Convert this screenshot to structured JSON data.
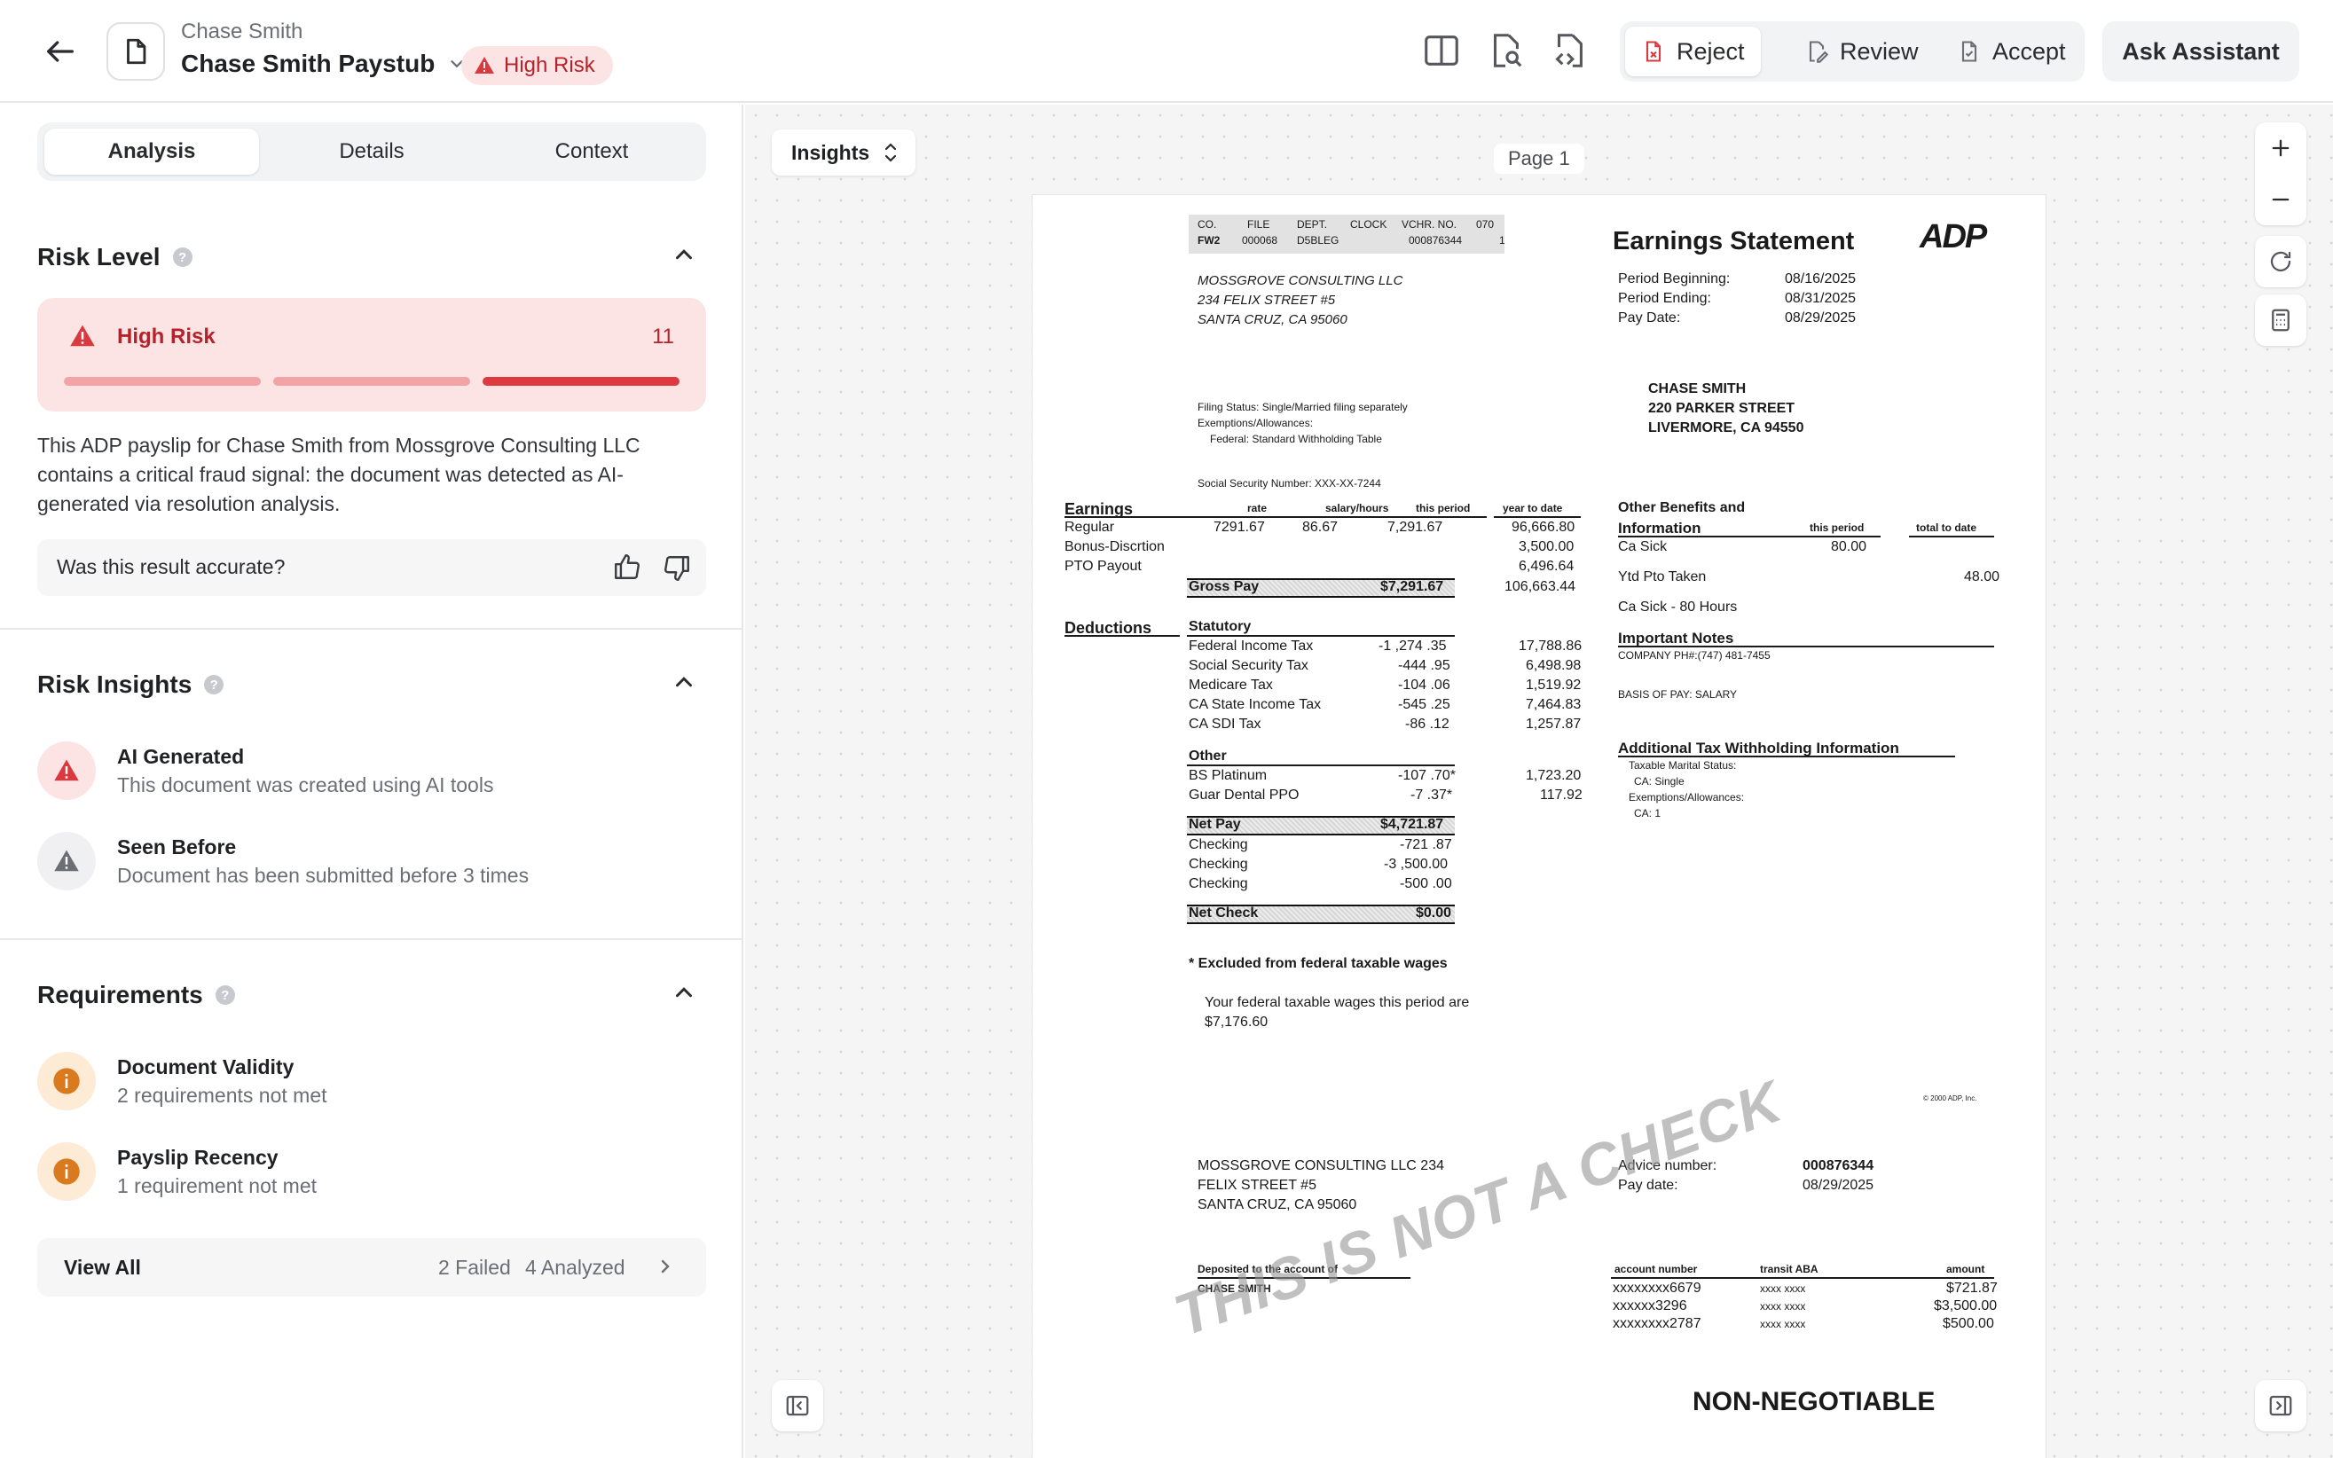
{
  "header": {
    "subtitle": "Chase Smith",
    "title": "Chase Smith Paystub",
    "risk_badge": "High Risk",
    "reject": "Reject",
    "review": "Review",
    "accept": "Accept",
    "ask": "Ask Assistant"
  },
  "tabs": [
    "Analysis",
    "Details",
    "Context"
  ],
  "risk": {
    "heading": "Risk Level",
    "level": "High Risk",
    "score": "11",
    "summary": "This ADP payslip for Chase Smith from Mossgrove Consulting LLC contains a critical fraud signal: the document was detected as AI-generated via resolution analysis.",
    "feedback": "Was this result accurate?"
  },
  "insights": {
    "heading": "Risk Insights",
    "items": [
      {
        "title": "AI Generated",
        "desc": "This document was created using AI tools"
      },
      {
        "title": "Seen Before",
        "desc": "Document has been submitted before 3 times"
      }
    ]
  },
  "requirements": {
    "heading": "Requirements",
    "items": [
      {
        "title": "Document Validity",
        "desc": "2 requirements not met"
      },
      {
        "title": "Payslip Recency",
        "desc": "1 requirement not met"
      }
    ],
    "view_all": "View All",
    "failed": "2 Failed",
    "analyzed": "4 Analyzed"
  },
  "viewer": {
    "insights_select": "Insights",
    "page_label": "Page 1"
  },
  "doc": {
    "code_hdr": [
      "CO.",
      "FILE",
      "DEPT.",
      "CLOCK",
      "VCHR. NO.",
      "070"
    ],
    "code_val": [
      "FW2",
      "000068",
      "D5BLEG",
      "000876344",
      "1"
    ],
    "company": [
      "MOSSGROVE    CONSULTING    LLC",
      "234  FELIX   STREET   #5",
      "SANTA   CRUZ,   CA  95060"
    ],
    "title": "Earnings  Statement",
    "logo": "ADP",
    "period_labels": [
      "Period  Beginning:",
      "Period  Ending:",
      "Pay  Date:"
    ],
    "period_values": [
      "08/16/2025",
      "08/31/2025",
      "08/29/2025"
    ],
    "employee": [
      "CHASE   SMITH",
      "220  PARKER   STREET",
      "LIVERMORE,  CA   94550"
    ],
    "filing": [
      "Filing  Status:  Single/Married    filing  separately",
      "Exemptions/Allowances:",
      "Federal:  Standard   Withholding   Table"
    ],
    "ssn": "Social  Security   Number:    XXX-XX-7244",
    "earn_hdr": {
      "title": "Earnings",
      "rate": "rate",
      "hours": "salary/hours",
      "period": "this  period",
      "ytd": "year  to  date"
    },
    "earnings": [
      {
        "name": "Regular",
        "rate": "7291.67",
        "hours": "86.67",
        "period": "7,291.67",
        "ytd": "96,666.80"
      },
      {
        "name": "Bonus-Discrtion",
        "rate": "",
        "hours": "",
        "period": "",
        "ytd": "3,500.00"
      },
      {
        "name": "PTO  Payout",
        "rate": "",
        "hours": "",
        "period": "",
        "ytd": "6,496.64"
      }
    ],
    "gross": {
      "label": "Gross  Pay",
      "period": "$7,291.67",
      "ytd": "106,663.44"
    },
    "ded_title": "Deductions",
    "statutory": "Statutory",
    "deductions": [
      {
        "name": "Federal  Income  Tax",
        "period": "-1 ,274 .35",
        "ytd": "17,788.86"
      },
      {
        "name": "Social  Security  Tax",
        "period": "-444 .95",
        "ytd": "6,498.98"
      },
      {
        "name": "Medicare  Tax",
        "period": "-104 .06",
        "ytd": "1,519.92"
      },
      {
        "name": "CA  State  Income  Tax",
        "period": "-545 .25",
        "ytd": "7,464.83"
      },
      {
        "name": "CA  SDI  Tax",
        "period": "-86 .12",
        "ytd": "1,257.87"
      }
    ],
    "other_title": "Other",
    "other": [
      {
        "name": "BS  Platinum",
        "period": "-107 .70*",
        "ytd": "1,723.20"
      },
      {
        "name": "Guar  Dental  PPO",
        "period": "-7 .37*",
        "ytd": "117.92"
      }
    ],
    "net": {
      "label": "Net  Pay",
      "period": "$4,721.87"
    },
    "checking": [
      {
        "name": "Checking",
        "val": "-721 .87"
      },
      {
        "name": "Checking",
        "val": "-3 ,500.00"
      },
      {
        "name": "Checking",
        "val": "-500 .00"
      }
    ],
    "net_check": {
      "label": "Net  Check",
      "val": "$0.00"
    },
    "excluded": "*  Excluded  from  federal  taxable  wages",
    "taxable": [
      "Your  federal  taxable  wages  this  period  are",
      "$7,176.60"
    ],
    "benefits": {
      "title1": "Other  Benefits   and",
      "title2": "Information",
      "period": "this  period",
      "total": "total  to  date",
      "rows": [
        {
          "name": "Ca  Sick",
          "period": "80.00",
          "total": ""
        },
        {
          "name": "Ytd  Pto  Taken",
          "period": "",
          "total": "48.00"
        },
        {
          "name": "Ca  Sick  -  80  Hours",
          "period": "",
          "total": ""
        }
      ]
    },
    "notes": {
      "title": "Important  Notes",
      "lines": [
        "COMPANY   PH#:(747)   481-7455",
        "BASIS  OF  PAY:  SALARY"
      ]
    },
    "addl": {
      "title": "Additional  Tax  Withholding  Information",
      "lines": [
        "Taxable   Marital  Status:",
        "CA:                      Single",
        "Exemptions/Allowances:",
        "CA:                      1"
      ]
    },
    "copyright": "© 2000  ADP,  Inc.",
    "advice_addr": [
      "MOSSGROVE CONSULTING LLC  234",
      "FELIX STREET #5",
      "SANTA CRUZ, CA 95060"
    ],
    "advice": {
      "num_label": "Advice  number:",
      "num": "000876344",
      "date_label": "Pay  date:",
      "date": "08/29/2025"
    },
    "dep_hdr": {
      "to": "Deposited   to  the  account   of",
      "acct": "account  number",
      "transit": "transit   ABA",
      "amount": "amount"
    },
    "dep_name": "CHASE   SMITH",
    "deposits": [
      {
        "acct": "xxxxxxxx6679",
        "transit": "xxxx  xxxx",
        "amount": "$721.87"
      },
      {
        "acct": "xxxxxx3296",
        "transit": "xxxx  xxxx",
        "amount": "$3,500.00"
      },
      {
        "acct": "xxxxxxxx2787",
        "transit": "xxxx  xxxx",
        "amount": "$500.00"
      }
    ],
    "watermark": "THIS IS NOT A CHECK",
    "nonneg": "NON-NEGOTIABLE"
  },
  "colors": {
    "risk": "#d83a3f",
    "warn": "#d97a1e",
    "accent_bg": "#fde4e4"
  }
}
